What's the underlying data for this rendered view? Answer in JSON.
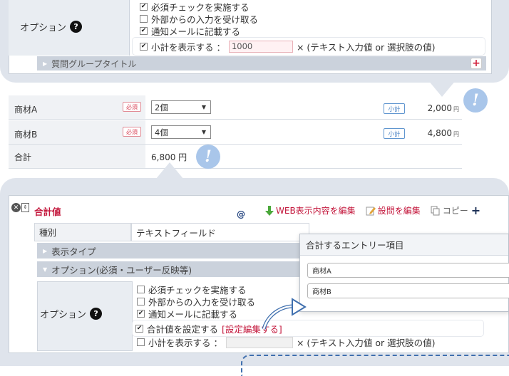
{
  "top": {
    "options_label": "オプション",
    "help_icon": "?",
    "options": [
      {
        "checked": true,
        "label": "必須チェックを実施する"
      },
      {
        "checked": false,
        "label": "外部からの入力を受け取る"
      },
      {
        "checked": true,
        "label": "通知メールに記載する"
      }
    ],
    "subtotal_option": {
      "checked": true,
      "label": "小計を表示する ：",
      "input_value": "1000",
      "suffix": "× (テキスト入力値 or 選択肢の値)"
    },
    "group_title": "質問グループタイトル",
    "plus": "+"
  },
  "table": {
    "rows": [
      {
        "label": "商材A",
        "required": "必須",
        "select_value": "2個",
        "subtotal_badge": "小計",
        "amount": "2,000",
        "unit": "円"
      },
      {
        "label": "商材B",
        "required": "必須",
        "select_value": "4個",
        "subtotal_badge": "小計",
        "amount": "4,800",
        "unit": "円"
      }
    ],
    "total_label": "合計",
    "total_value": "6,800 円",
    "bubble_mark": "!"
  },
  "bottom": {
    "block_title": "合計値",
    "at_mark": "@",
    "toolbar": {
      "web_edit": "WEB表示内容を編集",
      "question_edit": "設問を編集",
      "copy": "コピー",
      "plus": "+"
    },
    "type_label": "種別",
    "type_value": "テキストフィールド",
    "display_type": "表示タイプ",
    "options_section": "オプション(必須・ユーザー反映等)",
    "options_label": "オプション",
    "options": [
      {
        "checked": false,
        "label": "必須チェックを実施する"
      },
      {
        "checked": false,
        "label": "外部からの入力を受け取る"
      },
      {
        "checked": true,
        "label": "通知メールに記載する"
      }
    ],
    "total_option": {
      "checked": true,
      "label": "合計値を設定する",
      "link": "[設定編集する]"
    },
    "subtotal_option": {
      "checked": false,
      "label": "小計を表示する ：",
      "suffix": "× (テキスト入力値 or 選択肢の値)"
    },
    "popup": {
      "title": "合計するエントリー項目",
      "items": [
        "商材A",
        "商材B"
      ]
    }
  },
  "colors": {
    "accent_red": "#c3163b",
    "panel_bg": "#dfe4ec",
    "bubble": "#a9c6ea",
    "arrow_blue": "#3f6fae"
  }
}
